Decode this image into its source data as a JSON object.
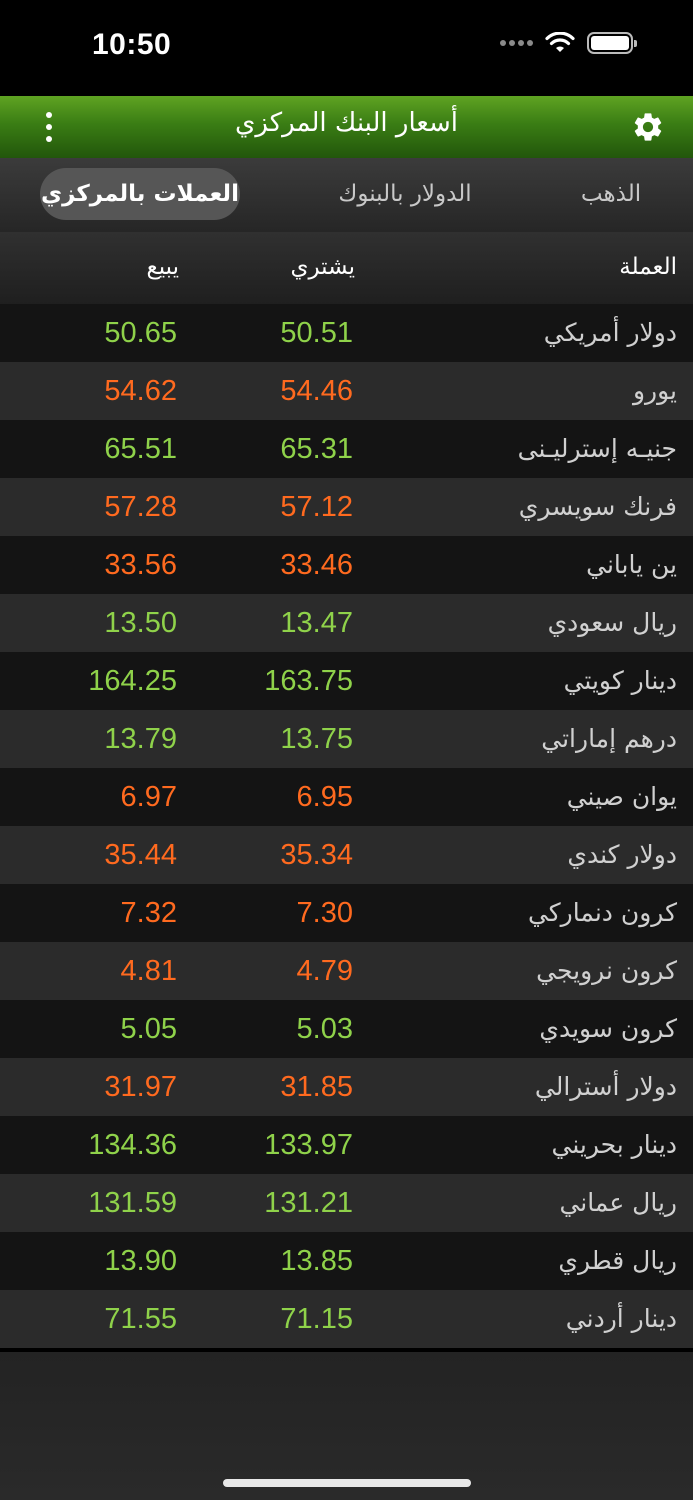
{
  "status_bar": {
    "time": "10:50"
  },
  "nav": {
    "title": "أسعار البنك المركزي"
  },
  "tabs": {
    "gold": "الذهب",
    "banks": "الدولار بالبنوك",
    "central": "العملات بالمركزي"
  },
  "table_header": {
    "currency": "العملة",
    "buy": "يشتري",
    "sell": "يبيع"
  },
  "colors": {
    "up": "#8fd24a",
    "down": "#ff6a1f"
  },
  "rates": [
    {
      "name": "دولار أمريكي",
      "buy": "50.51",
      "sell": "50.65",
      "trend": "up"
    },
    {
      "name": "يورو",
      "buy": "54.46",
      "sell": "54.62",
      "trend": "down"
    },
    {
      "name": "جنيـه إسترليـنى",
      "buy": "65.31",
      "sell": "65.51",
      "trend": "up"
    },
    {
      "name": "فرنك سويسري",
      "buy": "57.12",
      "sell": "57.28",
      "trend": "down"
    },
    {
      "name": "ين ياباني",
      "buy": "33.46",
      "sell": "33.56",
      "trend": "down"
    },
    {
      "name": "ريال سعودي",
      "buy": "13.47",
      "sell": "13.50",
      "trend": "up"
    },
    {
      "name": "دينار كويتي",
      "buy": "163.75",
      "sell": "164.25",
      "trend": "up"
    },
    {
      "name": "درهم إماراتي",
      "buy": "13.75",
      "sell": "13.79",
      "trend": "up"
    },
    {
      "name": "يوان صيني",
      "buy": "6.95",
      "sell": "6.97",
      "trend": "down"
    },
    {
      "name": "دولار كندي",
      "buy": "35.34",
      "sell": "35.44",
      "trend": "down"
    },
    {
      "name": "كرون دنماركي",
      "buy": "7.30",
      "sell": "7.32",
      "trend": "down"
    },
    {
      "name": "كرون نرويجي",
      "buy": "4.79",
      "sell": "4.81",
      "trend": "down"
    },
    {
      "name": "كرون سويدي",
      "buy": "5.03",
      "sell": "5.05",
      "trend": "up"
    },
    {
      "name": "دولار أسترالي",
      "buy": "31.85",
      "sell": "31.97",
      "trend": "down"
    },
    {
      "name": "دينار بحريني",
      "buy": "133.97",
      "sell": "134.36",
      "trend": "up"
    },
    {
      "name": "ريال عماني",
      "buy": "131.21",
      "sell": "131.59",
      "trend": "up"
    },
    {
      "name": "ريال قطري",
      "buy": "13.85",
      "sell": "13.90",
      "trend": "up"
    },
    {
      "name": "دينار أردني",
      "buy": "71.15",
      "sell": "71.55",
      "trend": "up"
    }
  ]
}
